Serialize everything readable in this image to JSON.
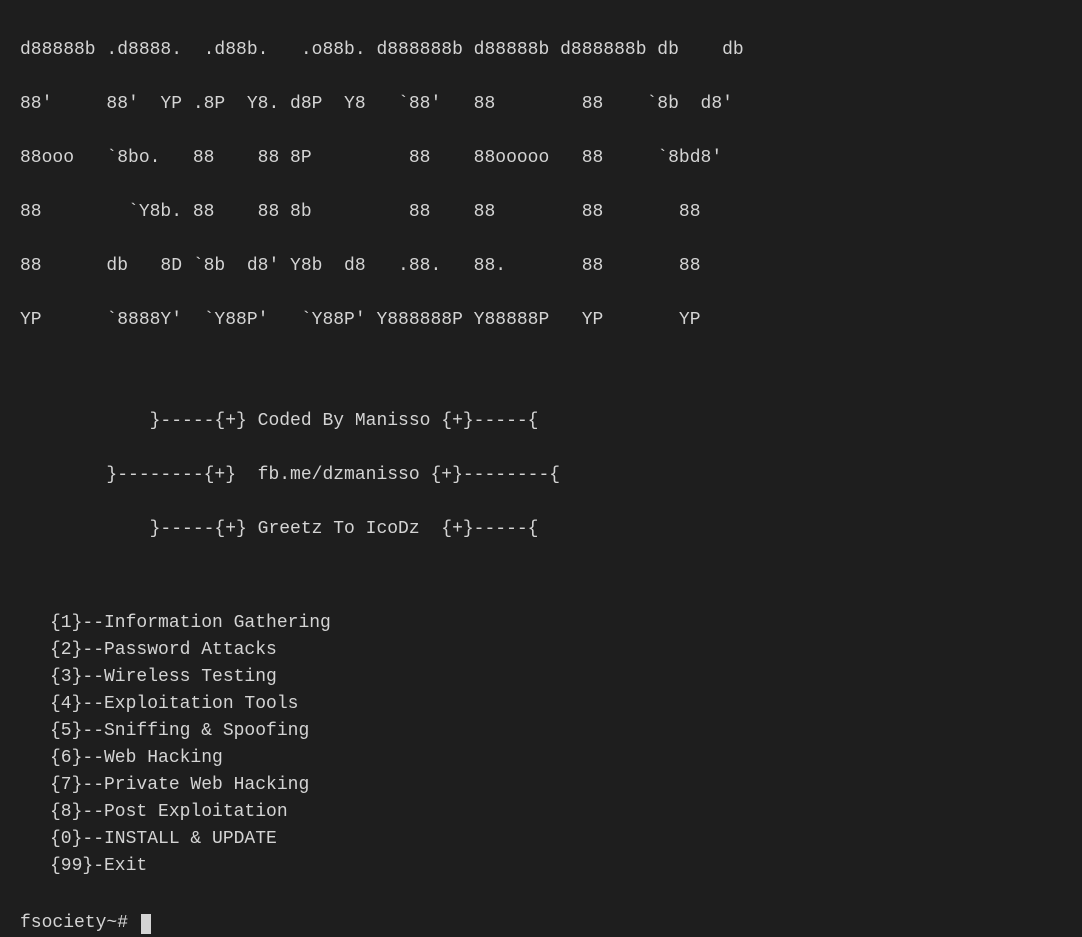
{
  "banner": {
    "line1": "d88888b .d8888.  .d88b.   .o88b. d888888b d88888b d888888b db    db",
    "line2": "88'     88'  YP .8P  Y8. d8P  Y8   `88'   88        88    `8b  d8'",
    "line3": "88ooo   `8bo.   88    88 8P         88    88ooooo   88     `8bd8'",
    "line4": "88        `Y8b. 88    88 8b         88    88        88       88",
    "line5": "88      db   8D `8b  d8' Y8b  d8   .88.   88.       88       88",
    "line6": "YP      `8888Y'  `Y88P'   `Y88P' Y888888P Y88888P   YP       YP"
  },
  "credits": {
    "line1": "            }-----{+} Coded By Manisso {+}-----{",
    "line2": "        }--------{+}  fb.me/dzmanisso {+}--------{",
    "line3": "            }-----{+} Greetz To IcoDz  {+}-----{"
  },
  "menu": {
    "items": [
      "{1}--Information Gathering",
      "{2}--Password Attacks",
      "{3}--Wireless Testing",
      "{4}--Exploitation Tools",
      "{5}--Sniffing & Spoofing",
      "{6}--Web Hacking",
      "{7}--Private Web Hacking",
      "{8}--Post Exploitation",
      "{0}--INSTALL & UPDATE",
      "{99}-Exit"
    ]
  },
  "prompt": "fsociety~# "
}
